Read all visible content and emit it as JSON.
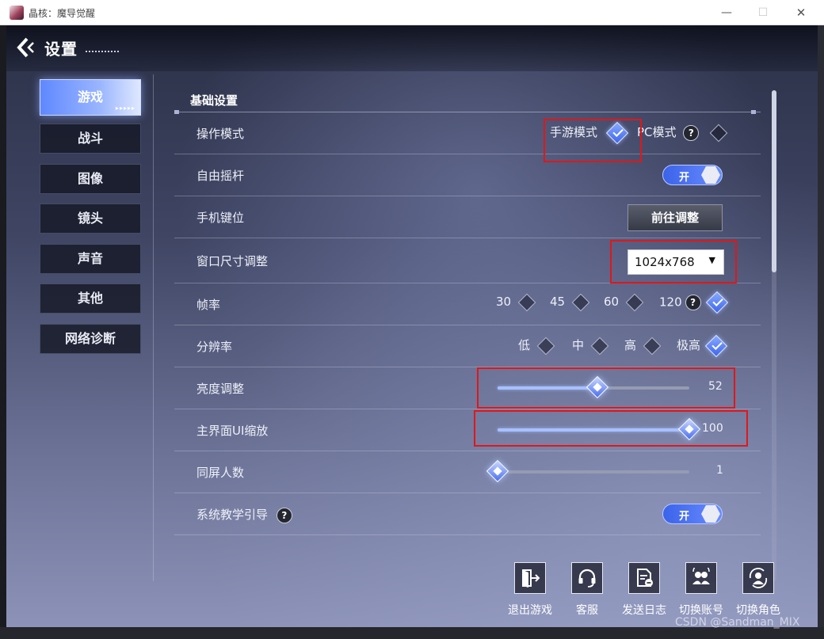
{
  "window": {
    "title": "晶核：魔导觉醒"
  },
  "header": {
    "title": "设置"
  },
  "nav": {
    "items": [
      "游戏",
      "战斗",
      "图像",
      "镜头",
      "声音",
      "其他",
      "网络诊断"
    ],
    "active_index": 0
  },
  "section": {
    "title": "基础设置"
  },
  "rows": {
    "control_mode": {
      "label": "操作模式",
      "options": [
        "手游模式",
        "PC模式"
      ],
      "selected": "手游模式"
    },
    "free_joystick": {
      "label": "自由摇杆",
      "toggle": "开"
    },
    "phone_keys": {
      "label": "手机键位",
      "button": "前往调整"
    },
    "window_size": {
      "label": "窗口尺寸调整",
      "value": "1024x768"
    },
    "fps": {
      "label": "帧率",
      "options": [
        "30",
        "45",
        "60",
        "120"
      ],
      "selected": "120"
    },
    "resolution": {
      "label": "分辨率",
      "options": [
        "低",
        "中",
        "高",
        "极高"
      ],
      "selected": "极高"
    },
    "brightness": {
      "label": "亮度调整",
      "value": "52",
      "fraction": 0.52
    },
    "ui_scale": {
      "label": "主界面UI缩放",
      "value": "100",
      "fraction": 1.0
    },
    "players_on_screen": {
      "label": "同屏人数",
      "value": "1",
      "fraction": 0.0
    },
    "tutorial": {
      "label": "系统教学引导",
      "toggle": "开"
    }
  },
  "actions": [
    "退出游戏",
    "客服",
    "发送日志",
    "切换账号",
    "切换角色"
  ],
  "watermark": "CSDN @Sandman_MIX",
  "colors": {
    "accent": "#5b7ef5",
    "highlight_box": "#e0171a"
  }
}
